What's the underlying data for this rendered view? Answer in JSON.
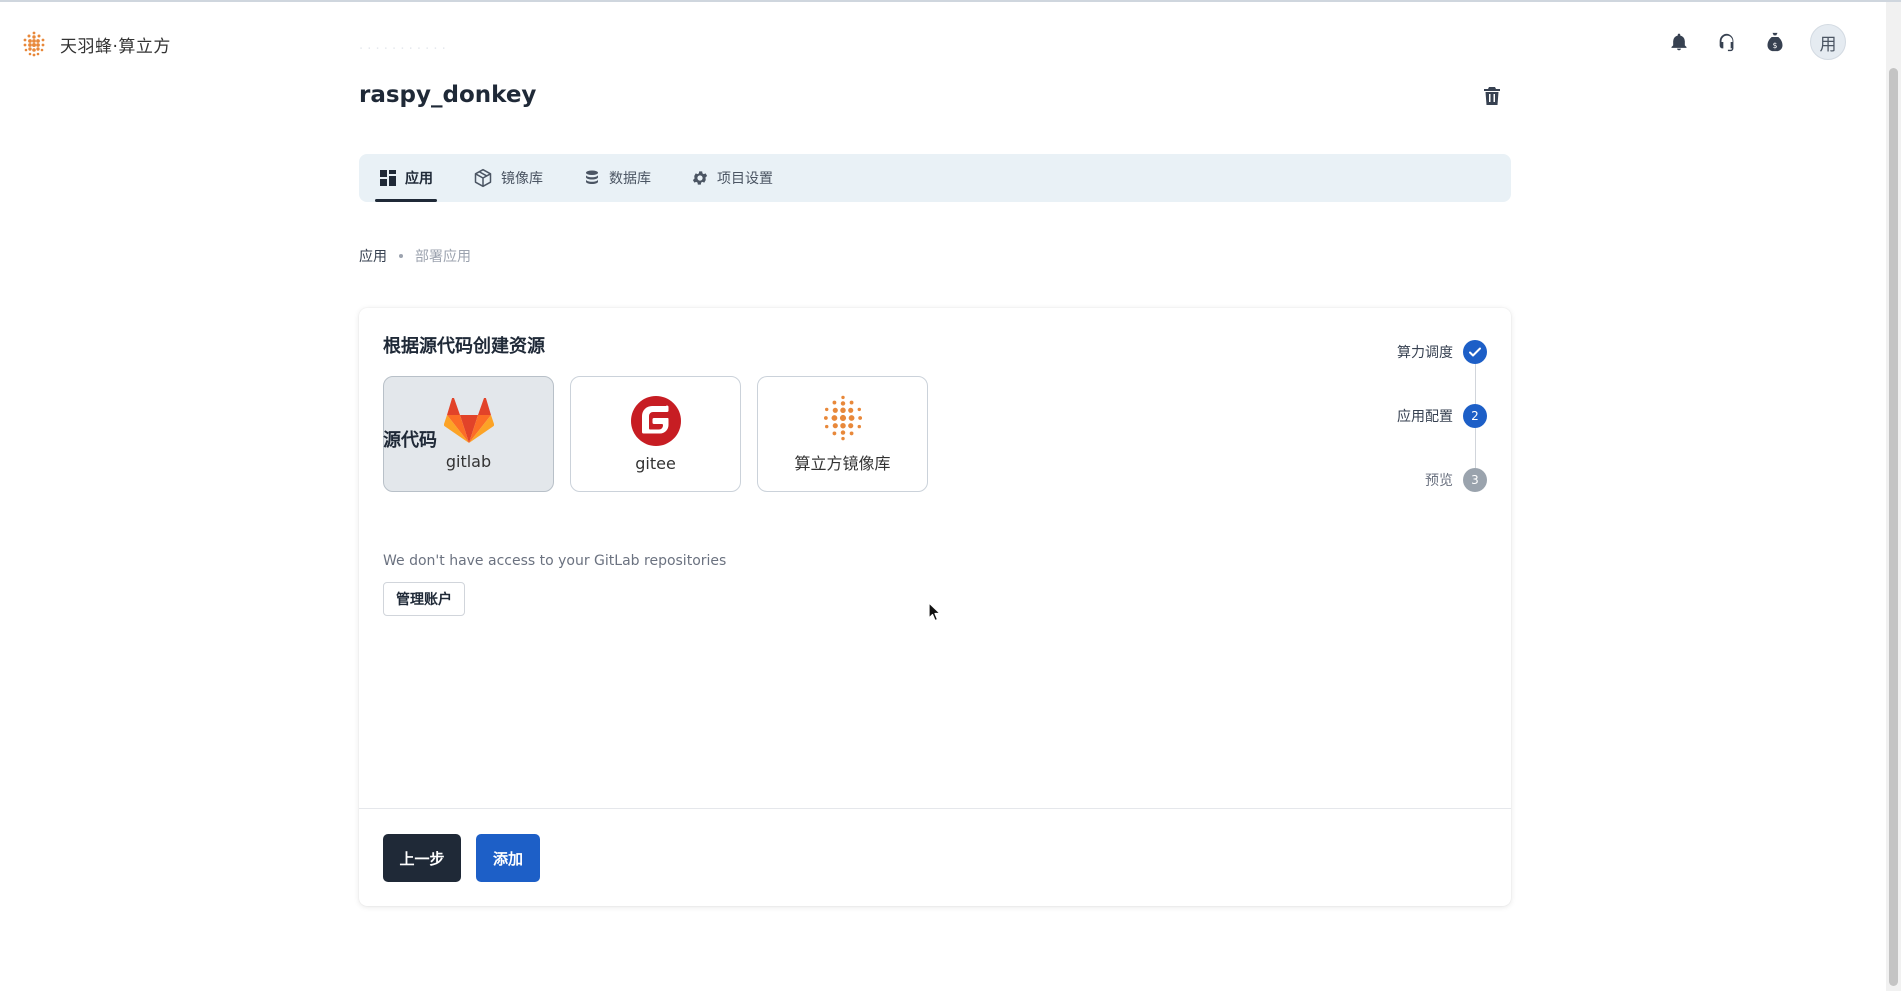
{
  "header": {
    "brand_name": "天羽蜂·算立方",
    "avatar_text": "用",
    "icons": [
      "bell-icon",
      "headset-icon",
      "money-bag-icon"
    ]
  },
  "project": {
    "title": "raspy_donkey"
  },
  "tabs": [
    {
      "label": "应用",
      "icon": "apps-grid-icon",
      "active": true
    },
    {
      "label": "镜像库",
      "icon": "cube-icon",
      "active": false
    },
    {
      "label": "数据库",
      "icon": "database-icon",
      "active": false
    },
    {
      "label": "项目设置",
      "icon": "gear-icon",
      "active": false
    }
  ],
  "breadcrumb": {
    "parent": "应用",
    "current": "部署应用"
  },
  "create": {
    "title": "根据源代码创建资源",
    "sources": [
      {
        "label": "gitlab",
        "icon": "gitlab-icon",
        "selected": true
      },
      {
        "label": "gitee",
        "icon": "gitee-icon",
        "selected": false
      },
      {
        "label": "算立方镜像库",
        "icon": "slf-registry-icon",
        "selected": false
      }
    ],
    "source_code_title": "源代码",
    "hint": "We don't have access to your GitLab repositories",
    "manage_label": "管理账户",
    "prev_label": "上一步",
    "add_label": "添加"
  },
  "stepper": [
    {
      "label": "算力调度",
      "state": "done",
      "marker": ""
    },
    {
      "label": "应用配置",
      "state": "active",
      "marker": "2"
    },
    {
      "label": "预览",
      "state": "pending",
      "marker": "3"
    }
  ],
  "colors": {
    "primary": "#1d5fc7",
    "dark": "#1f2937",
    "tabs_bg": "#e9f1f6",
    "brand_orange": "#e8883a"
  }
}
